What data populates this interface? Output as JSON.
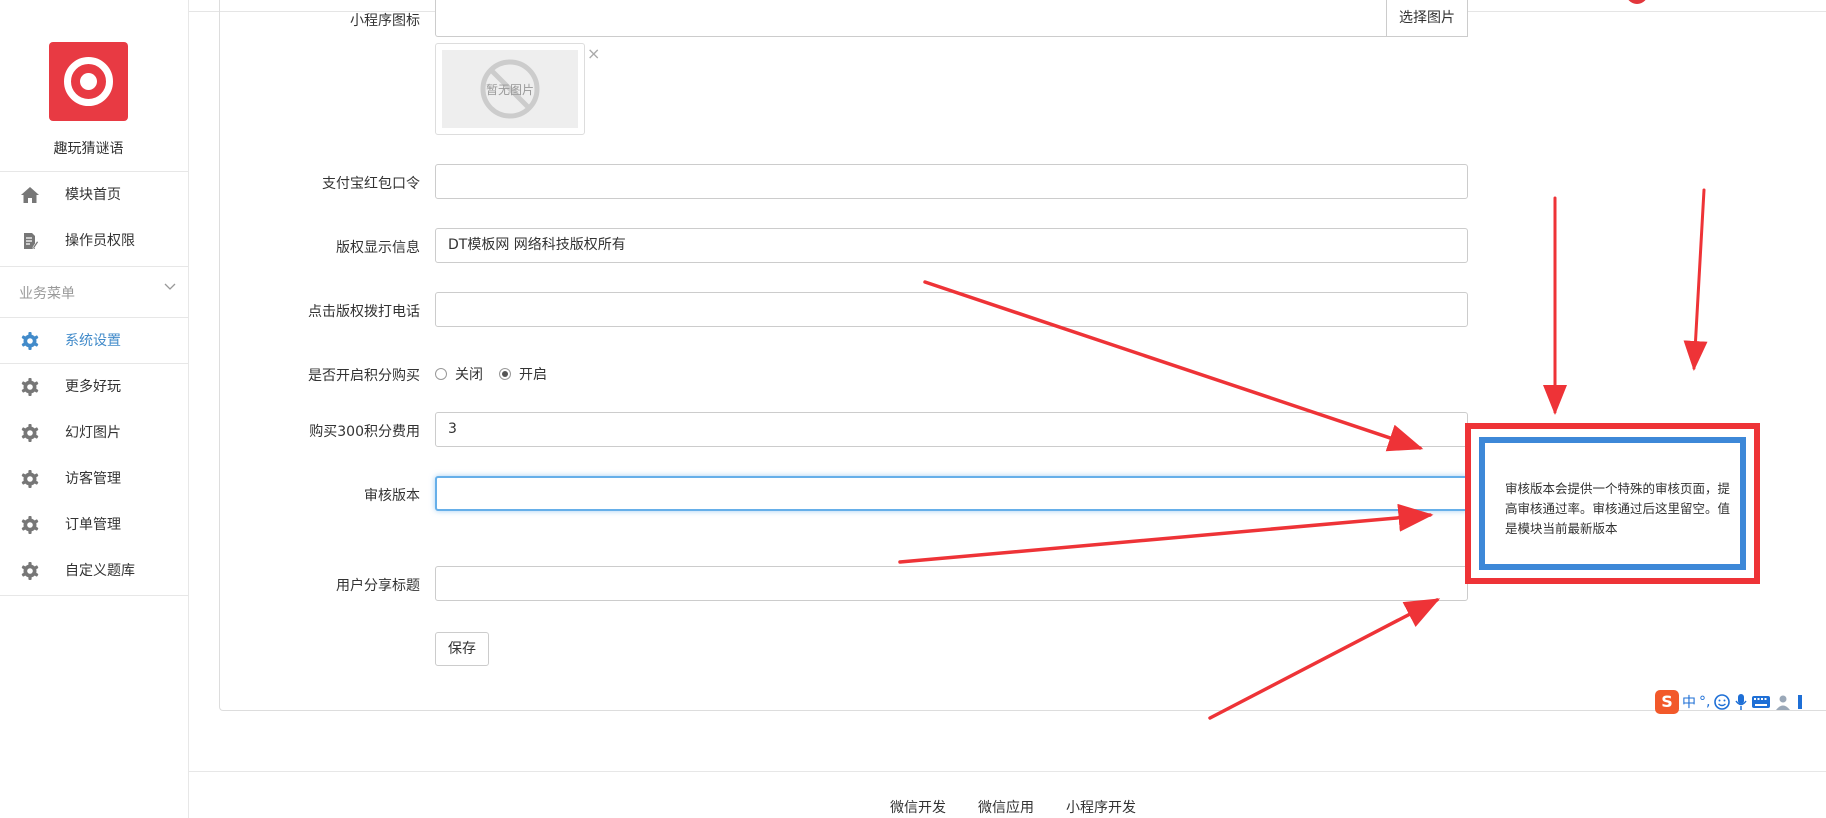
{
  "app": {
    "name": "趣玩猜谜语"
  },
  "sidebar": {
    "items": [
      {
        "label": "模块首页",
        "icon": "home-icon"
      },
      {
        "label": "操作员权限",
        "icon": "document-edit-icon"
      }
    ],
    "group_title": "业务菜单",
    "group_items": [
      {
        "label": "系统设置",
        "icon": "gear-icon",
        "active": true
      },
      {
        "label": "更多好玩",
        "icon": "gear-icon"
      },
      {
        "label": "幻灯图片",
        "icon": "gear-icon"
      },
      {
        "label": "访客管理",
        "icon": "gear-icon"
      },
      {
        "label": "订单管理",
        "icon": "gear-icon"
      },
      {
        "label": "自定义题库",
        "icon": "gear-icon"
      }
    ]
  },
  "form": {
    "miniapp_icon": {
      "label": "小程序图标",
      "value": "",
      "button": "选择图片",
      "placeholder_image_text": "暂无图片"
    },
    "alipay_password": {
      "label": "支付宝红包口令",
      "value": ""
    },
    "copyright_info": {
      "label": "版权显示信息",
      "value": "DT模板网 网络科技版权所有"
    },
    "copyright_phone": {
      "label": "点击版权拨打电话",
      "value": ""
    },
    "points_purchase": {
      "label": "是否开启积分购买",
      "options": [
        "关闭",
        "开启"
      ],
      "selected": "开启"
    },
    "points_cost": {
      "label": "购买300积分费用",
      "value": "3"
    },
    "review_version": {
      "label": "审核版本",
      "value": ""
    },
    "share_title": {
      "label": "用户分享标题",
      "value": ""
    },
    "save_label": "保存"
  },
  "annotation": {
    "text": "审核版本会提供一个特殊的审核页面，提高审核通过率。审核通过后这里留空。值是模块当前最新版本"
  },
  "footer": {
    "links": [
      "微信开发",
      "微信应用",
      "小程序开发"
    ]
  },
  "ime": {
    "logo": "S",
    "mode": "中",
    "punct": "°,"
  },
  "colors": {
    "accent": "#428bca",
    "annotation_red": "#ee3337",
    "annotation_blue": "#3d88d8",
    "logo_red": "#e83a43"
  }
}
